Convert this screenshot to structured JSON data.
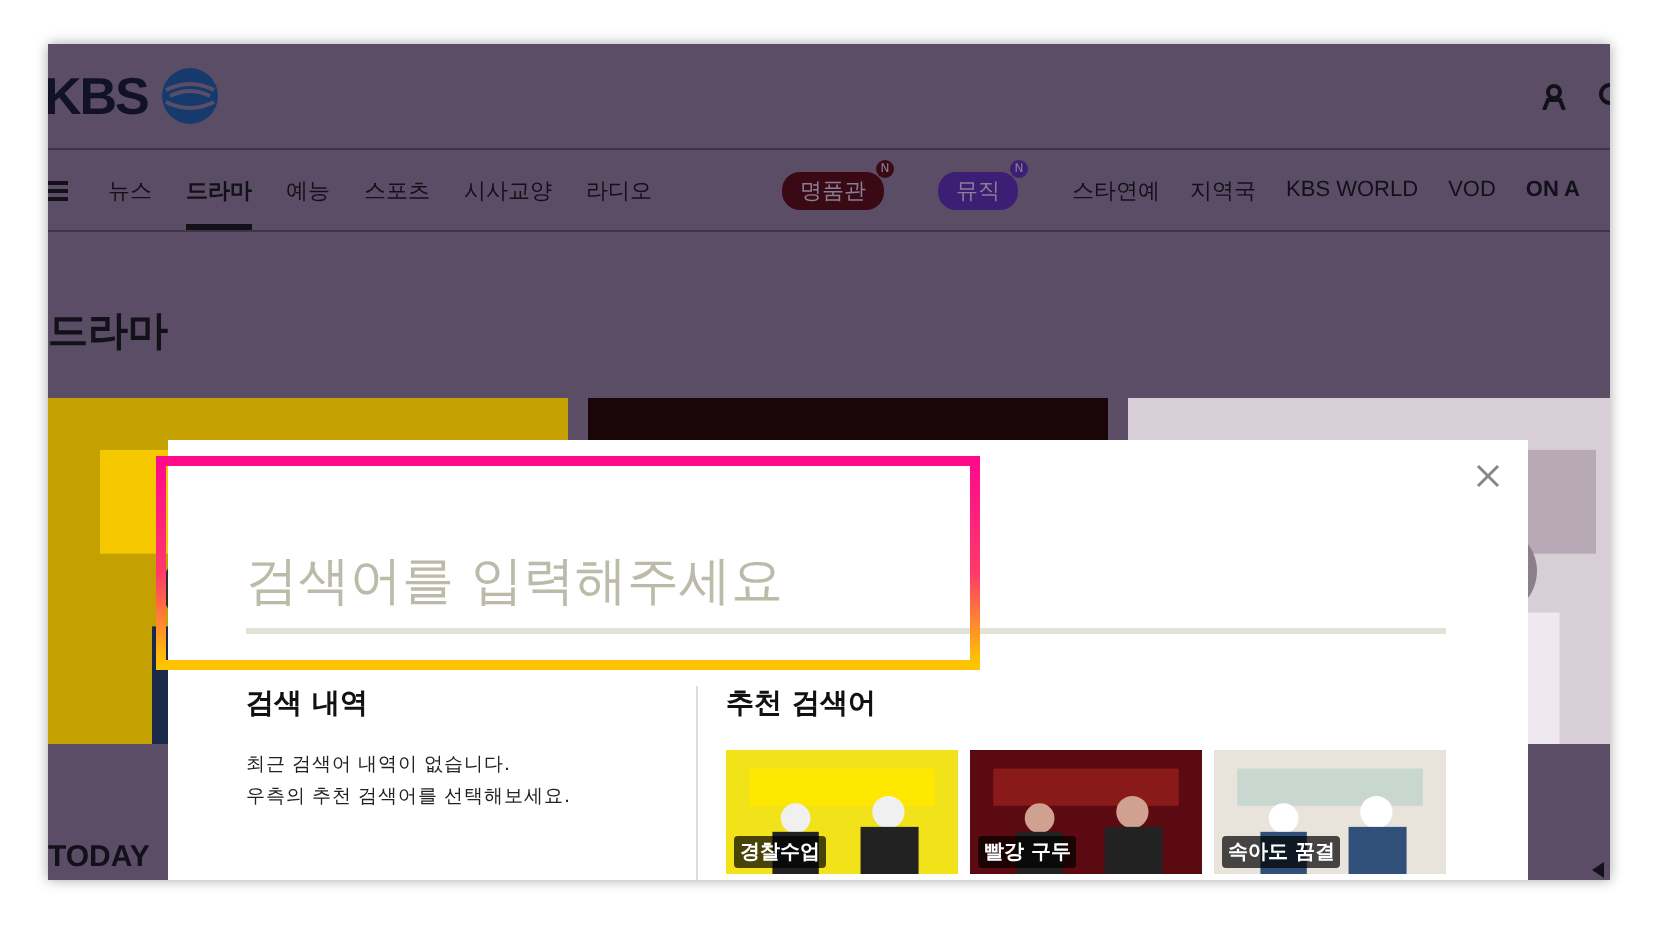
{
  "header": {
    "logo": "KBS"
  },
  "nav": [
    {
      "label": "뉴스",
      "selected": false
    },
    {
      "label": "드라마",
      "selected": true
    },
    {
      "label": "예능",
      "selected": false
    },
    {
      "label": "스포츠",
      "selected": false
    },
    {
      "label": "시사교양",
      "selected": false
    },
    {
      "label": "라디오",
      "selected": false
    }
  ],
  "nav_extra": [
    {
      "kind": "pill",
      "label": "명품관",
      "badge": "N",
      "color": "#3a0a14"
    },
    {
      "kind": "pill",
      "label": "뮤직",
      "badge": "N",
      "color": "#3c1f74"
    },
    {
      "kind": "link",
      "label": "스타연예"
    },
    {
      "kind": "link",
      "label": "지역국"
    },
    {
      "kind": "link",
      "label": "KBS WORLD"
    },
    {
      "kind": "link",
      "label": "VOD"
    },
    {
      "kind": "bold",
      "label": "ON A"
    }
  ],
  "section_title": "드라마",
  "today_label": "TODAY",
  "search_modal": {
    "placeholder": "검색어를 입력해주세요",
    "history": {
      "title": "검색 내역",
      "lines": [
        "최근 검색어 내역이 없습니다.",
        "우측의 추천 검색어를 선택해보세요."
      ]
    },
    "recommended": {
      "title": "추천 검색어",
      "items": [
        {
          "caption": "경찰수업"
        },
        {
          "caption": "빨강 구두"
        },
        {
          "caption": "속아도 꿈결"
        }
      ]
    }
  }
}
